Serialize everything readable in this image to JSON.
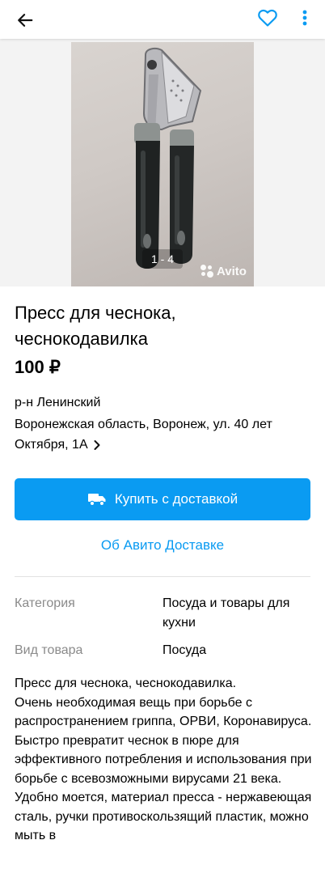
{
  "header": {
    "back_icon": "arrow-left-icon",
    "favorite_icon": "heart-outline-icon",
    "more_icon": "more-vert-icon",
    "accent_color": "#0a9bf2"
  },
  "gallery": {
    "counter": "1 - 4",
    "watermark": "Avito"
  },
  "listing": {
    "title": "Пресс для чеснока, чеснокодавилка",
    "price": "100 ₽",
    "district": "р-н Ленинский",
    "address": "Воронежская область, Воронеж, ул. 40 лет Октября, 1А"
  },
  "actions": {
    "buy_label": "Купить с доставкой",
    "buy_icon": "truck-icon",
    "about_delivery": "Об Авито Доставке"
  },
  "params": [
    {
      "label": "Категория",
      "value": "Посуда и товары для кухни"
    },
    {
      "label": "Вид товара",
      "value": "Посуда"
    }
  ],
  "description": "Пресс для чеснока, чеснокодавилка.\nОчень необходимая вещь при борьбе с распространением гриппа, ОРВИ, Коронавируса.\nБыстро превратит  чеснок в пюре для эффективного потребления и использования при борьбе с всевозможными вирусами 21 века.\nУдобно моется, материал пресса - нержавеющая сталь, ручки противоскользящий пластик, можно мыть в"
}
